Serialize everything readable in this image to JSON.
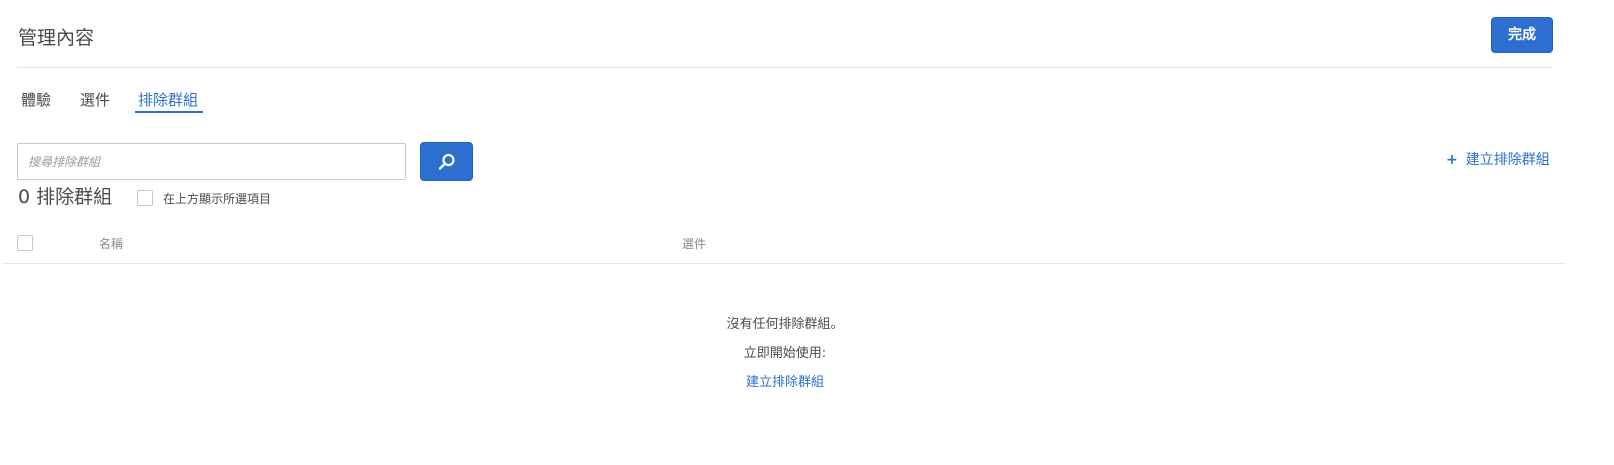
{
  "header": {
    "title": "管理內容",
    "done_label": "完成"
  },
  "tabs": [
    {
      "label": "體驗",
      "active": false
    },
    {
      "label": "選件",
      "active": false
    },
    {
      "label": "排除群組",
      "active": true
    }
  ],
  "search": {
    "placeholder": "搜尋排除群組",
    "value": "",
    "button_icon": "search-icon"
  },
  "create_link": {
    "icon": "plus-icon",
    "label": "建立排除群組"
  },
  "summary": {
    "count_label": "0 排除群組",
    "show_selected_label": "在上方顯示所選項目",
    "show_selected_checked": false
  },
  "table": {
    "columns": [
      "名稱",
      "選件"
    ],
    "rows": []
  },
  "empty_state": {
    "title": "沒有任何排除群組。",
    "subtitle": "立即開始使用:",
    "link_label": "建立排除群組"
  },
  "colors": {
    "accent": "#2c6fd0",
    "text": "#4b4b4b",
    "muted": "#8a8a8a",
    "divider": "#e1e1e1"
  }
}
